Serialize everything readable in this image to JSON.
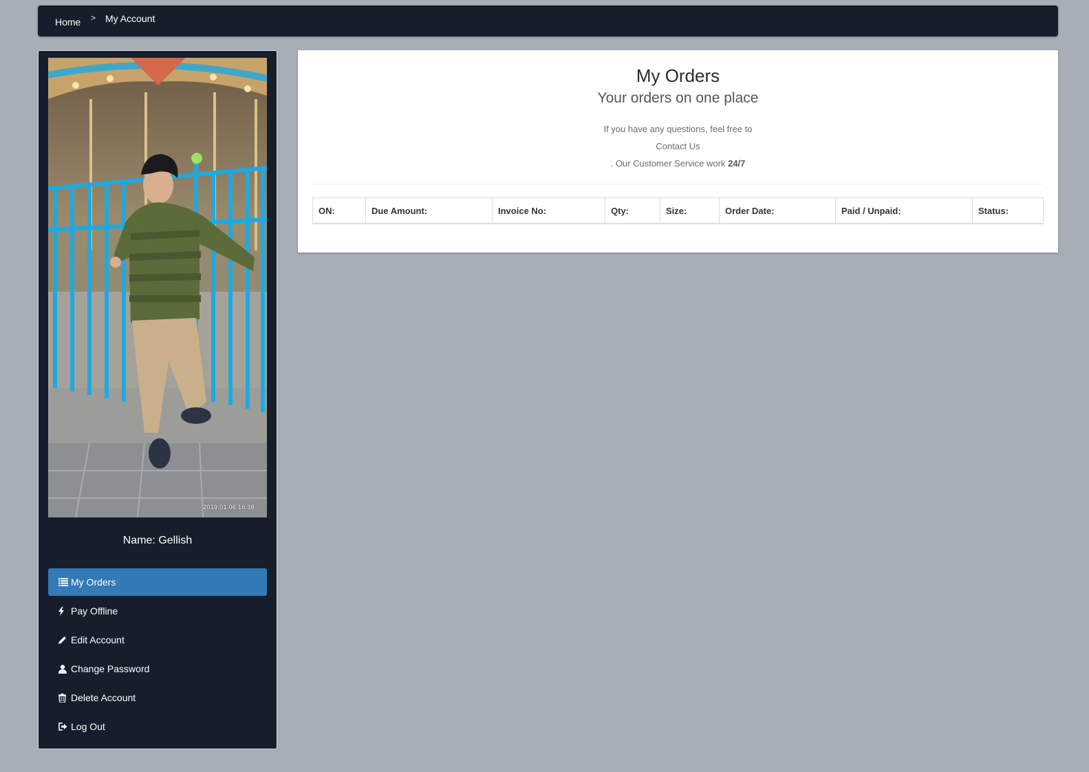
{
  "breadcrumb": {
    "home": "Home",
    "separator": ">",
    "current": "My Account"
  },
  "sidebar": {
    "photo_timestamp": "2019.01.06 16:38",
    "user_name": "Name: Gellish",
    "items": [
      {
        "label": "My Orders",
        "icon": "list-icon",
        "active": true
      },
      {
        "label": "Pay Offline",
        "icon": "bolt-icon",
        "active": false
      },
      {
        "label": "Edit Account",
        "icon": "pencil-icon",
        "active": false
      },
      {
        "label": "Change Password",
        "icon": "user-icon",
        "active": false
      },
      {
        "label": "Delete Account",
        "icon": "trash-icon",
        "active": false
      },
      {
        "label": "Log Out",
        "icon": "sign-out-icon",
        "active": false
      }
    ]
  },
  "main": {
    "title": "My Orders",
    "subtitle": "Your orders on one place",
    "info_line1": "If you have any questions, feel free to",
    "contact_link": "Contact Us",
    "info_line3_prefix": ". Our Customer Service work ",
    "info_line3_bold": "24/7",
    "table_headers": [
      "ON:",
      "Due Amount:",
      "Invoice No:",
      "Qty:",
      "Size:",
      "Order Date:",
      "Paid / Unpaid:",
      "Status:"
    ]
  },
  "colors": {
    "page_background": "#a7aeb7",
    "dark_panel": "#171e2b",
    "active_nav": "#337ab7"
  }
}
